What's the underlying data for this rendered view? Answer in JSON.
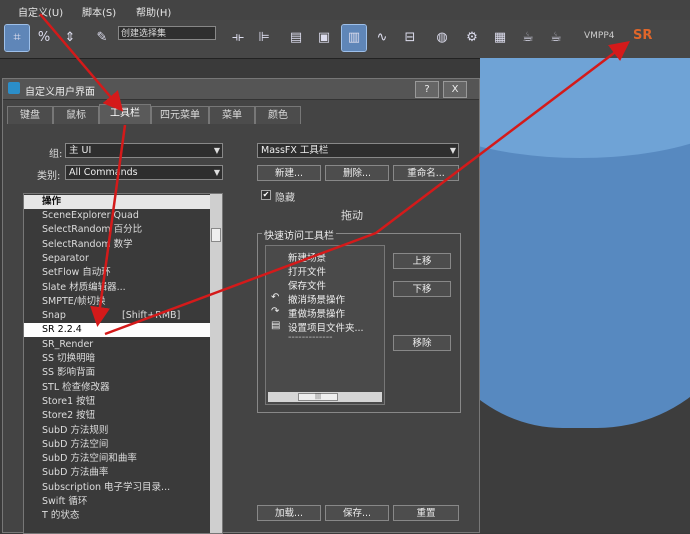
{
  "menu": {
    "customize": "自定义(U)",
    "script": "脚本(S)",
    "help": "帮助(H)"
  },
  "toolbar": {
    "selection_set_placeholder": "创建选择集",
    "vmpp_label": "VMPP4",
    "sr_label": "SR"
  },
  "dialog": {
    "title": "自定义用户界面",
    "help_btn": "?",
    "close_btn": "X",
    "tabs": [
      "键盘",
      "鼠标",
      "工具栏",
      "四元菜单",
      "菜单",
      "颜色"
    ],
    "active_tab": "工具栏",
    "group_label": "组:",
    "group_value": "主 UI",
    "category_label": "类别:",
    "category_value": "All Commands",
    "actions_header": "操作",
    "actions": [
      {
        "text": "SceneExplorer Quad",
        "hotkey": ""
      },
      {
        "text": "SelectRandom 百分比",
        "hotkey": ""
      },
      {
        "text": "SelectRandom 数学",
        "hotkey": ""
      },
      {
        "text": "Separator",
        "hotkey": ""
      },
      {
        "text": "SetFlow 自动环",
        "hotkey": ""
      },
      {
        "text": "Slate 材质编辑器...",
        "hotkey": ""
      },
      {
        "text": "SMPTE/帧切换",
        "hotkey": ""
      },
      {
        "text": "Snap",
        "hotkey": "[Shift+RMB]"
      },
      {
        "text": "SR 2.2.4",
        "hotkey": ""
      },
      {
        "text": "SR_Render",
        "hotkey": ""
      },
      {
        "text": "SS 切换明暗",
        "hotkey": ""
      },
      {
        "text": "SS 影响背面",
        "hotkey": ""
      },
      {
        "text": "STL 检查修改器",
        "hotkey": ""
      },
      {
        "text": "Store1 按钮",
        "hotkey": ""
      },
      {
        "text": "Store2 按钮",
        "hotkey": ""
      },
      {
        "text": "SubD 方法规则",
        "hotkey": ""
      },
      {
        "text": "SubD 方法空间",
        "hotkey": ""
      },
      {
        "text": "SubD 方法空间和曲率",
        "hotkey": ""
      },
      {
        "text": "SubD 方法曲率",
        "hotkey": ""
      },
      {
        "text": "Subscription 电子学习目录...",
        "hotkey": ""
      },
      {
        "text": "Swift 循环",
        "hotkey": ""
      },
      {
        "text": "T 的状态",
        "hotkey": ""
      }
    ],
    "selected_action": "SR 2.2.4",
    "toolbar_select_value": "MassFX 工具栏",
    "new_btn": "新建...",
    "delete_btn": "删除...",
    "rename_btn": "重命名...",
    "hide_label": "隐藏",
    "hide_checked": "✔",
    "drag_label": "拖动",
    "quick_access_label": "快速访问工具栏",
    "quick_items": [
      "新建场景",
      "打开文件",
      "保存文件",
      "撤消场景操作",
      "重做场景操作",
      "设置项目文件夹...",
      "-------------"
    ],
    "move_up_btn": "上移",
    "move_down_btn": "下移",
    "remove_btn": "移除",
    "load_btn": "加载...",
    "save_btn": "保存...",
    "reset_btn": "重置"
  },
  "colors": {
    "arrow": "#d41a1a",
    "selection_accent": "#5f86b8",
    "viewport_object": "#5789c0"
  }
}
